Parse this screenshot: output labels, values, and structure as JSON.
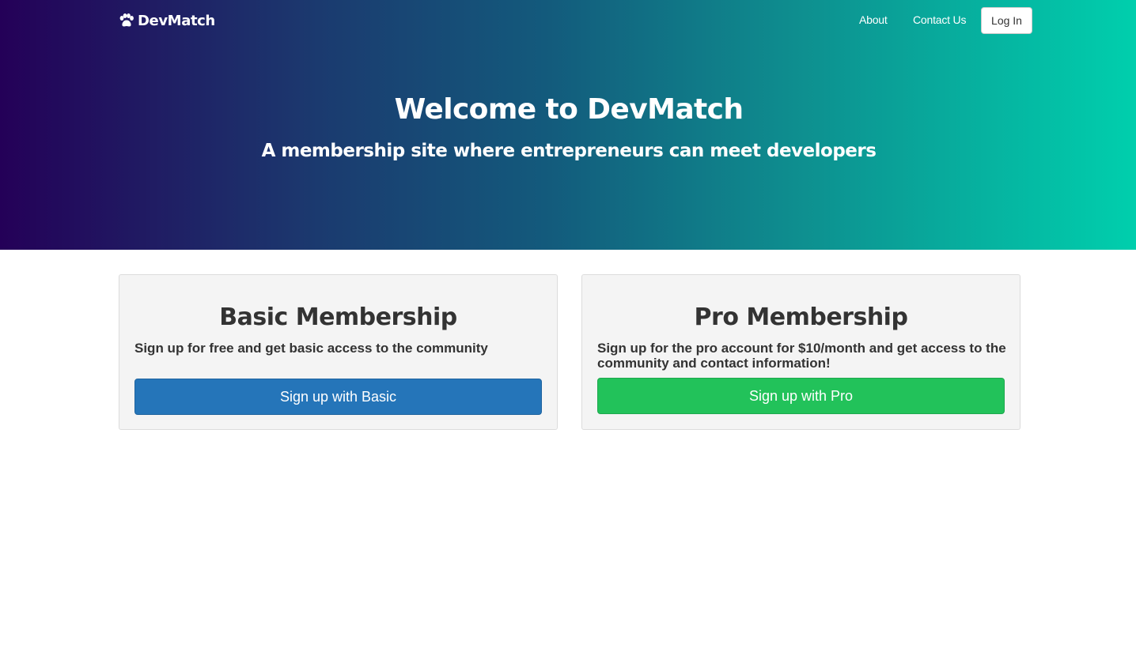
{
  "nav": {
    "brand": "DevMatch",
    "brand_icon": "paw-icon",
    "about": "About",
    "contact": "Contact Us",
    "login": "Log In"
  },
  "hero": {
    "title": "Welcome to DevMatch",
    "subtitle": "A membership site where entrepreneurs can meet developers"
  },
  "plans": {
    "basic": {
      "title": "Basic Membership",
      "description": "Sign up for free and get basic access to the community",
      "button": "Sign up with Basic",
      "button_color": "#2575b9"
    },
    "pro": {
      "title": "Pro Membership",
      "description": "Sign up for the pro account for $10/month and get access to the community and contact information!",
      "button": "Sign up with Pro",
      "button_color": "#22c25a"
    }
  },
  "colors": {
    "gradient_start": "#240058",
    "gradient_end": "#00cfad",
    "card_background": "#f4f4f4"
  }
}
